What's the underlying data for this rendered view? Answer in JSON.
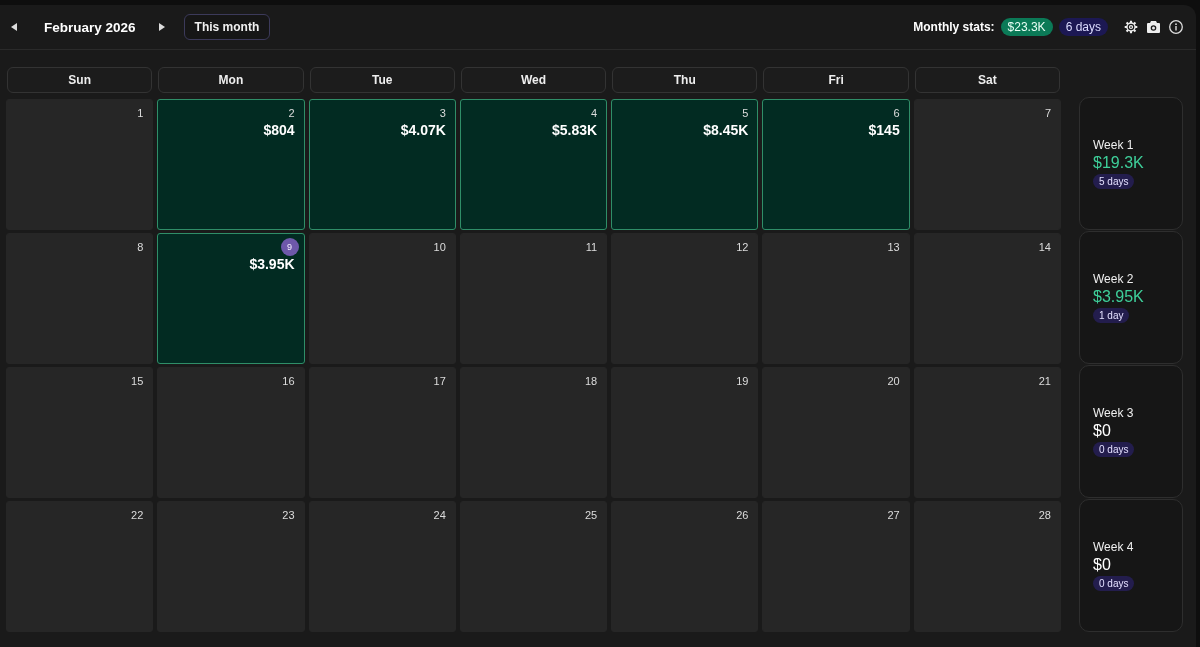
{
  "header": {
    "title": "February 2026",
    "today_button": "This month",
    "stats_label": "Monthly stats:",
    "stats_total": "$23.3K",
    "stats_days": "6 days"
  },
  "calendar": {
    "weekdays": [
      "Sun",
      "Mon",
      "Tue",
      "Wed",
      "Thu",
      "Fri",
      "Sat"
    ],
    "weeks": [
      {
        "days": [
          {
            "day": "1",
            "active": false,
            "today": false
          },
          {
            "day": "2",
            "active": true,
            "today": false,
            "amount": "$804"
          },
          {
            "day": "3",
            "active": true,
            "today": false,
            "amount": "$4.07K"
          },
          {
            "day": "4",
            "active": true,
            "today": false,
            "amount": "$5.83K"
          },
          {
            "day": "5",
            "active": true,
            "today": false,
            "amount": "$8.45K"
          },
          {
            "day": "6",
            "active": true,
            "today": false,
            "amount": "$145"
          },
          {
            "day": "7",
            "active": false,
            "today": false
          }
        ],
        "summary": {
          "label": "Week 1",
          "total": "$19.3K",
          "days": "5 days",
          "active": true
        }
      },
      {
        "days": [
          {
            "day": "8",
            "active": false,
            "today": false
          },
          {
            "day": "9",
            "active": true,
            "today": true,
            "amount": "$3.95K"
          },
          {
            "day": "10",
            "active": false,
            "today": false
          },
          {
            "day": "11",
            "active": false,
            "today": false
          },
          {
            "day": "12",
            "active": false,
            "today": false
          },
          {
            "day": "13",
            "active": false,
            "today": false
          },
          {
            "day": "14",
            "active": false,
            "today": false
          }
        ],
        "summary": {
          "label": "Week 2",
          "total": "$3.95K",
          "days": "1 day",
          "active": true
        }
      },
      {
        "days": [
          {
            "day": "15",
            "active": false,
            "today": false
          },
          {
            "day": "16",
            "active": false,
            "today": false
          },
          {
            "day": "17",
            "active": false,
            "today": false
          },
          {
            "day": "18",
            "active": false,
            "today": false
          },
          {
            "day": "19",
            "active": false,
            "today": false
          },
          {
            "day": "20",
            "active": false,
            "today": false
          },
          {
            "day": "21",
            "active": false,
            "today": false
          }
        ],
        "summary": {
          "label": "Week 3",
          "total": "$0",
          "days": "0 days",
          "active": false
        }
      },
      {
        "days": [
          {
            "day": "22",
            "active": false,
            "today": false
          },
          {
            "day": "23",
            "active": false,
            "today": false
          },
          {
            "day": "24",
            "active": false,
            "today": false
          },
          {
            "day": "25",
            "active": false,
            "today": false
          },
          {
            "day": "26",
            "active": false,
            "today": false
          },
          {
            "day": "27",
            "active": false,
            "today": false
          },
          {
            "day": "28",
            "active": false,
            "today": false
          }
        ],
        "summary": {
          "label": "Week 4",
          "total": "$0",
          "days": "0 days",
          "active": false
        }
      }
    ]
  }
}
